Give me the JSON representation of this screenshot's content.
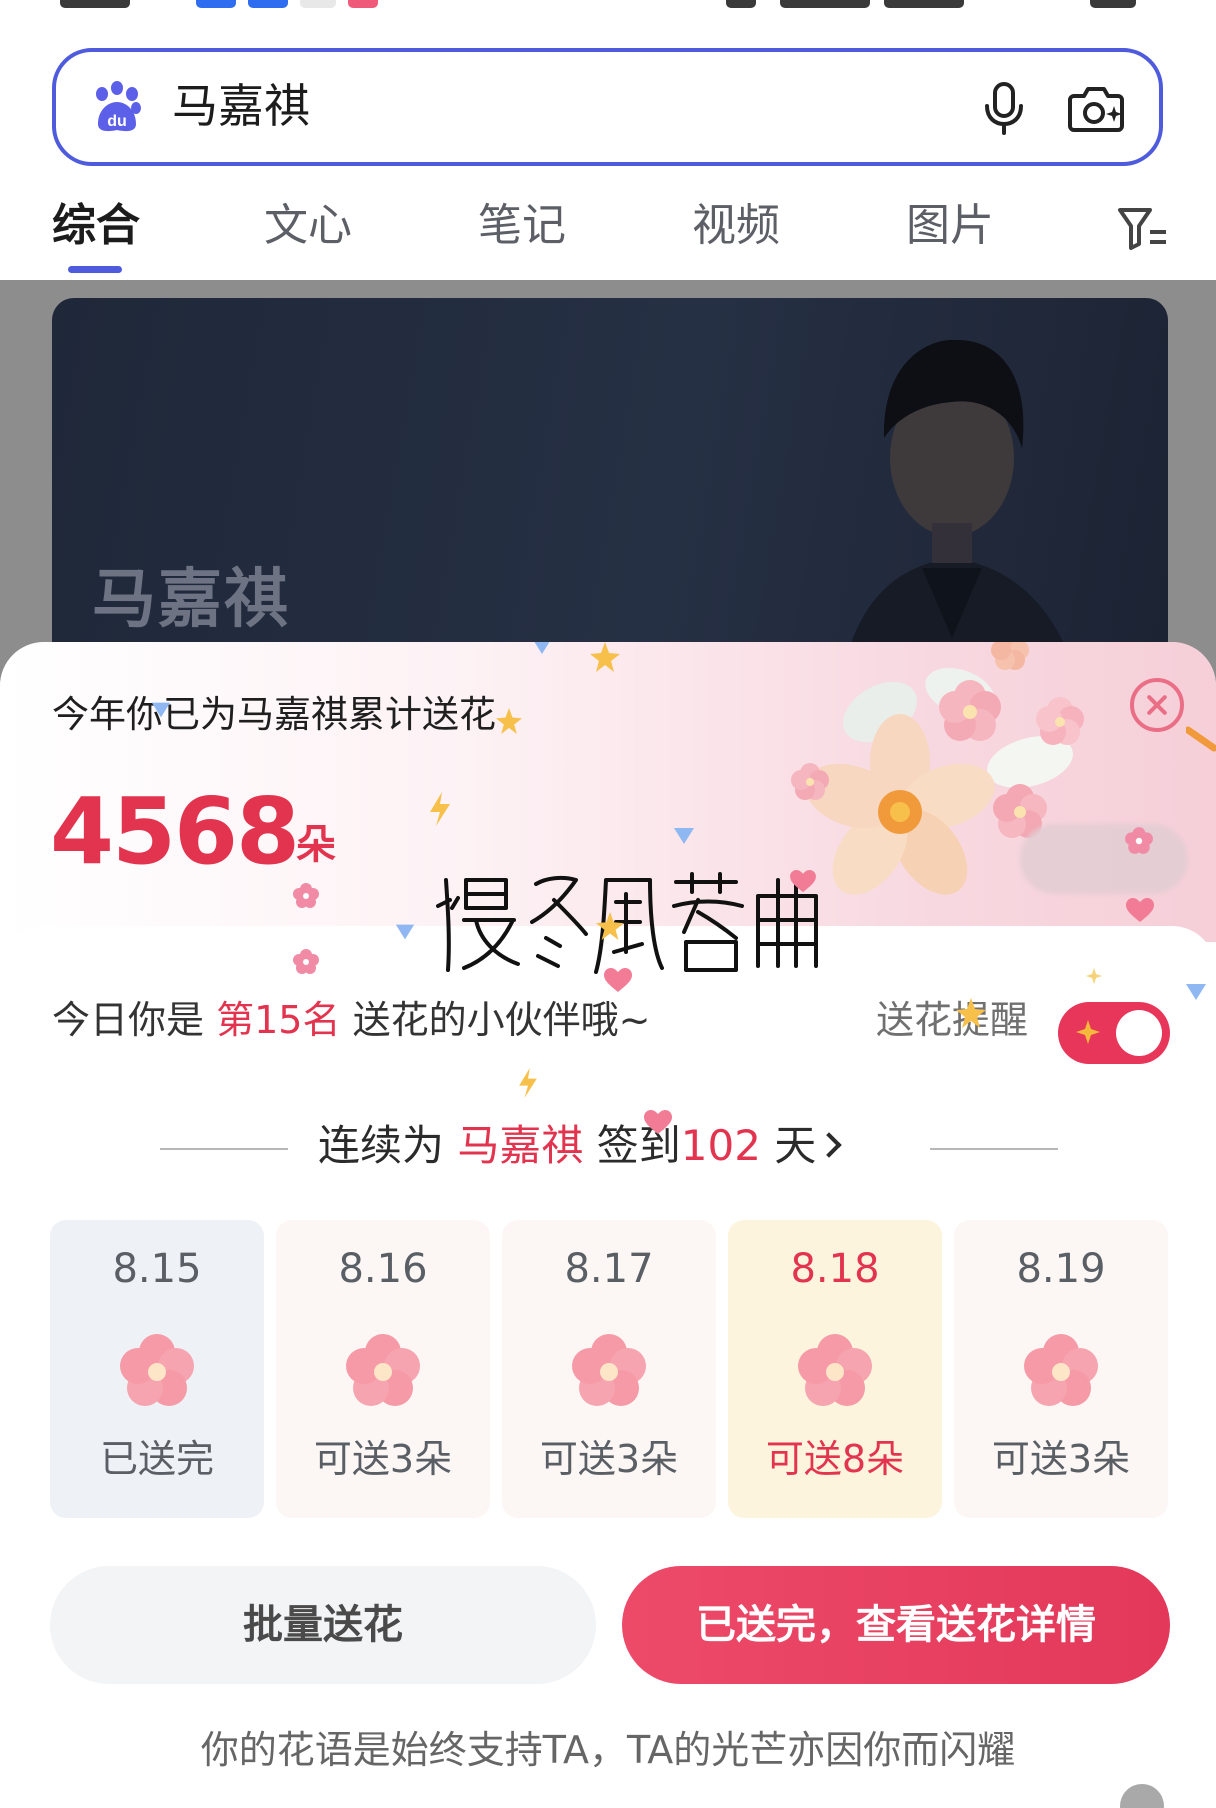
{
  "search": {
    "query": "马嘉祺",
    "logo_icon": "baidu-paw-icon",
    "voice_icon": "microphone-icon",
    "image_search_icon": "camera-icon"
  },
  "tabs": [
    {
      "label": "综合",
      "active": true
    },
    {
      "label": "文心",
      "active": false
    },
    {
      "label": "笔记",
      "active": false
    },
    {
      "label": "视频",
      "active": false
    },
    {
      "label": "图片",
      "active": false
    }
  ],
  "hero": {
    "name": "马嘉祺"
  },
  "flower_sheet": {
    "total_caption": "今年你已为马嘉祺累计送花",
    "total_count": "4568",
    "total_unit": "朵",
    "rank_prefix": "今日你是",
    "rank_value": "第15名",
    "rank_suffix": "送花的小伙伴哦~",
    "reminder_label": "送花提醒",
    "reminder_on": true,
    "streak_prefix": "连续为",
    "streak_name": "马嘉祺",
    "streak_mid": "签到",
    "streak_days": "102",
    "streak_unit": "天",
    "days": [
      {
        "date": "8.15",
        "status": "已送完"
      },
      {
        "date": "8.16",
        "status": "可送3朵"
      },
      {
        "date": "8.17",
        "status": "可送3朵"
      },
      {
        "date": "8.18",
        "status": "可送8朵"
      },
      {
        "date": "8.19",
        "status": "可送3朵"
      }
    ],
    "batch_button": "批量送花",
    "detail_button": "已送完，查看送花详情",
    "slogan": "你的花语是始终支持TA，TA的光芒亦因你而闪耀"
  },
  "colors": {
    "accent_blue": "#4e5bdc",
    "accent_red": "#e3344f"
  }
}
